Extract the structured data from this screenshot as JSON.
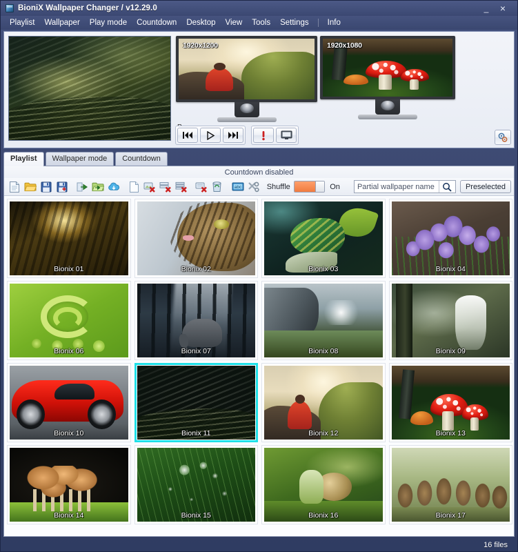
{
  "window": {
    "title": "BioniX Wallpaper Changer /",
    "version": "v12.29.0",
    "minimize_label": "_",
    "close_label": "×"
  },
  "menu": {
    "items": [
      {
        "label": "Playlist"
      },
      {
        "label": "Wallpaper"
      },
      {
        "label": "Play mode"
      },
      {
        "label": "Countdown"
      },
      {
        "label": "Desktop"
      },
      {
        "label": "View"
      },
      {
        "label": "Tools"
      },
      {
        "label": "Settings"
      },
      {
        "label": "Info"
      }
    ]
  },
  "preview": {
    "monitors": [
      {
        "resolution": "1920x1200",
        "label": "P"
      },
      {
        "resolution": "1920x1080",
        "label": ""
      }
    ],
    "transport": {
      "previous": "Previous wallpaper",
      "play": "Play",
      "next": "Next wallpaper",
      "alert": "Alert",
      "desktop": "Desktop"
    },
    "settings_button": "Settings"
  },
  "tabs": [
    {
      "label": "Playlist",
      "active": true
    },
    {
      "label": "Wallpaper mode",
      "active": false
    },
    {
      "label": "Countdown",
      "active": false
    }
  ],
  "countdown": {
    "status": "Countdown disabled"
  },
  "toolbar": {
    "icons": [
      {
        "name": "new-playlist-icon",
        "title": "New playlist"
      },
      {
        "name": "open-playlist-icon",
        "title": "Open playlist"
      },
      {
        "name": "save-playlist-icon",
        "title": "Save playlist"
      },
      {
        "name": "save-playlist-as-icon",
        "title": "Save playlist as"
      },
      {
        "name": "import-wallpaper-icon",
        "title": "Add wallpaper"
      },
      {
        "name": "import-folder-icon",
        "title": "Add folder"
      },
      {
        "name": "download-cloud-icon",
        "title": "Download wallpapers"
      },
      {
        "name": "blank-page-icon",
        "title": "Blank"
      },
      {
        "name": "remove-wallpaper-icon",
        "title": "Remove wallpaper"
      },
      {
        "name": "remove-selected-icon",
        "title": "Remove selected"
      },
      {
        "name": "remove-list-icon",
        "title": "Remove list"
      },
      {
        "name": "delete-entry-icon",
        "title": "Delete entry"
      },
      {
        "name": "recycle-bin-icon",
        "title": "Recycle bin"
      },
      {
        "name": "rename-icon",
        "title": "Rename"
      },
      {
        "name": "tools-icon",
        "title": "Tools"
      }
    ],
    "shuffle_label": "Shuffle",
    "shuffle_state": "On",
    "preselected_label": "Preselected"
  },
  "search": {
    "placeholder": "Partial wallpaper name",
    "value": "",
    "icon": "search-icon"
  },
  "playlist": {
    "selected_index": 10,
    "items": [
      {
        "label": "Bionix 01",
        "art": "art-01"
      },
      {
        "label": "Bionix 02",
        "art": "art-02"
      },
      {
        "label": "Bionix 03",
        "art": "art-03"
      },
      {
        "label": "Bionix 04",
        "art": "art-04"
      },
      {
        "label": "Bionix 06",
        "art": "art-06"
      },
      {
        "label": "Bionix 07",
        "art": "art-07"
      },
      {
        "label": "Bionix 08",
        "art": "art-08"
      },
      {
        "label": "Bionix 09",
        "art": "art-09"
      },
      {
        "label": "Bionix 10",
        "art": "art-10"
      },
      {
        "label": "Bionix 11",
        "art": "art-11"
      },
      {
        "label": "Bionix 12",
        "art": "art-12"
      },
      {
        "label": "Bionix 13",
        "art": "art-13"
      },
      {
        "label": "Bionix 14",
        "art": "art-14"
      },
      {
        "label": "Bionix 15",
        "art": "art-15"
      },
      {
        "label": "Bionix 16",
        "art": "art-16"
      },
      {
        "label": "Bionix 17",
        "art": "art-17"
      }
    ]
  },
  "status": {
    "file_count": "16 files"
  },
  "colors": {
    "title_bar": "#46537f",
    "selection": "#1fe0e8",
    "shuffle_on": "#f07b3f",
    "panel": "#f4f6fa"
  }
}
